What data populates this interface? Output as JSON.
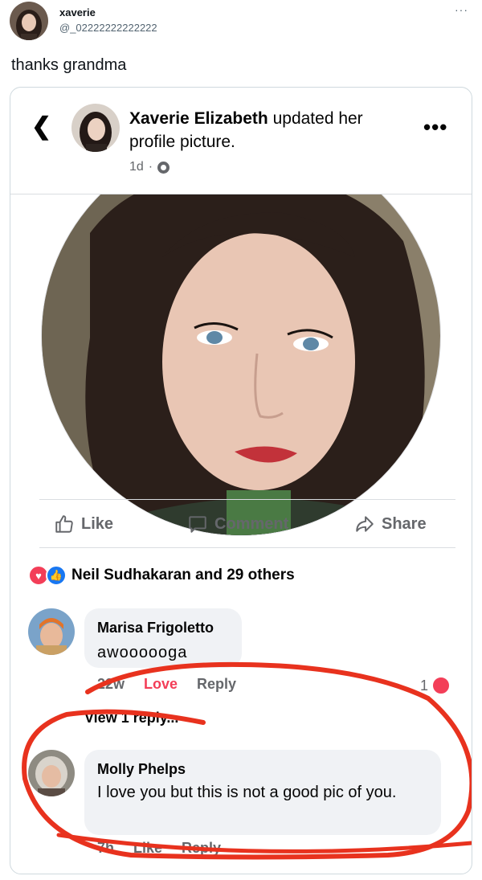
{
  "tweet": {
    "user_name": "xaverie",
    "handle": "@_02222222222222",
    "more_icon": "ellipsis-icon",
    "text": "thanks grandma"
  },
  "fb_post": {
    "back_icon": "back-chevron-icon",
    "author": "Xaverie Elizabeth",
    "action_text": " updated her profile picture.",
    "timestamp": "1d",
    "audience_icon": "globe-icon",
    "more_icon": "more-dots-icon"
  },
  "actions": {
    "like": "Like",
    "comment": "Comment",
    "share": "Share"
  },
  "reactions_summary": "Neil Sudhakaran and 29 others",
  "comments": [
    {
      "author": "Marisa Frigoletto",
      "text": "awoooooga",
      "time": "22w",
      "reaction_label": "Love",
      "reply_label": "Reply",
      "reaction_count": "1",
      "view_replies": "View 1 reply..."
    },
    {
      "author": "Molly Phelps",
      "text": "I love you but this is not a good pic of you.",
      "time": "7h",
      "like_label": "Like",
      "reply_label": "Reply"
    }
  ],
  "colors": {
    "love_red": "#f33e58",
    "like_blue": "#1877f2",
    "annotation_red": "#e8321e",
    "fb_gray": "#65676b"
  }
}
